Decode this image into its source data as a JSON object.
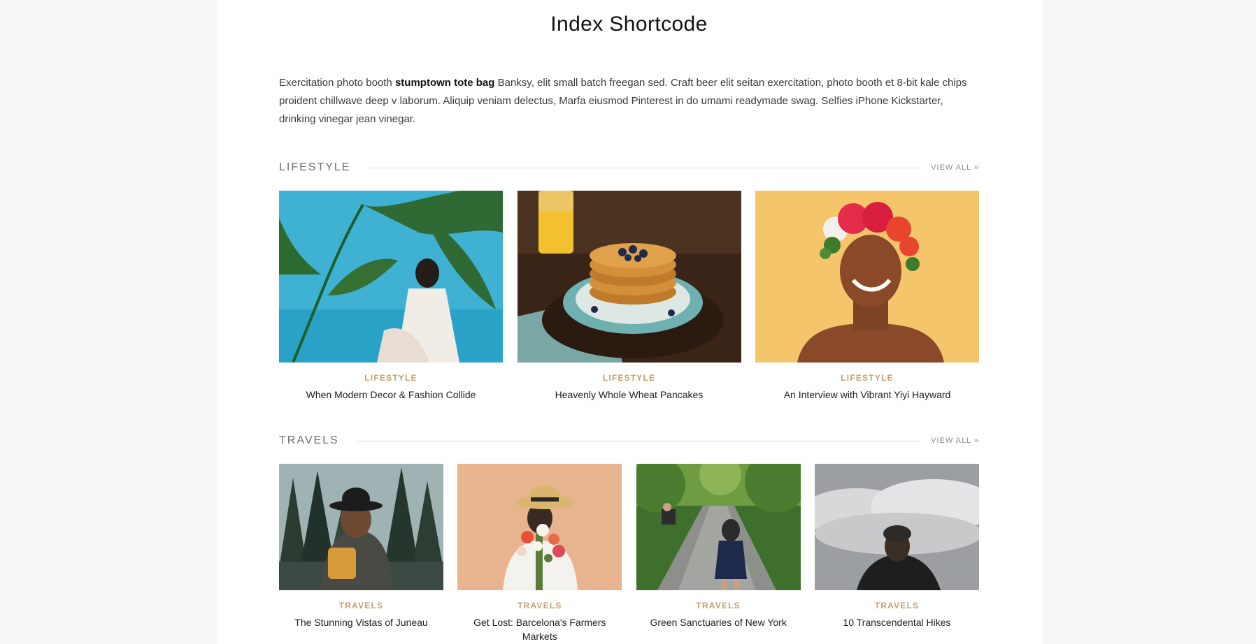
{
  "page": {
    "title": "Index Shortcode",
    "intro": {
      "before": "Exercitation photo booth ",
      "bold": "stumptown tote bag",
      "after": " Banksy, elit small batch freegan sed. Craft beer elit seitan exercitation, photo booth et 8-bit kale chips proident chillwave deep v laborum. Aliquip veniam delectus, Marfa eiusmod Pinterest in do umami readymade swag. Selfies iPhone Kickstarter, drinking vinegar jean vinegar."
    }
  },
  "colors": {
    "accent": "#c3a06d",
    "rule": "#dedede",
    "background": "#f7f7f7"
  },
  "sections": [
    {
      "name": "LIFESTYLE",
      "view_all": "VIEW ALL »",
      "posts": [
        {
          "category": "LIFESTYLE",
          "title": "When Modern Decor & Fashion Collide",
          "image": "woman-with-palm-on-blue"
        },
        {
          "category": "LIFESTYLE",
          "title": "Heavenly Whole Wheat Pancakes",
          "image": "pancakes-with-blueberries"
        },
        {
          "category": "LIFESTYLE",
          "title": "An Interview with Vibrant Yiyi Hayward",
          "image": "woman-flower-crown"
        }
      ]
    },
    {
      "name": "TRAVELS",
      "view_all": "VIEW ALL »",
      "posts": [
        {
          "category": "TRAVELS",
          "title": "The Stunning Vistas of Juneau",
          "image": "hiker-forest-lake"
        },
        {
          "category": "TRAVELS",
          "title": "Get Lost: Barcelona's Farmers Markets",
          "image": "woman-with-bouquet"
        },
        {
          "category": "TRAVELS",
          "title": "Green Sanctuaries of New York",
          "image": "park-path"
        },
        {
          "category": "TRAVELS",
          "title": "10 Transcendental Hikes",
          "image": "hiker-above-clouds"
        }
      ]
    }
  ]
}
